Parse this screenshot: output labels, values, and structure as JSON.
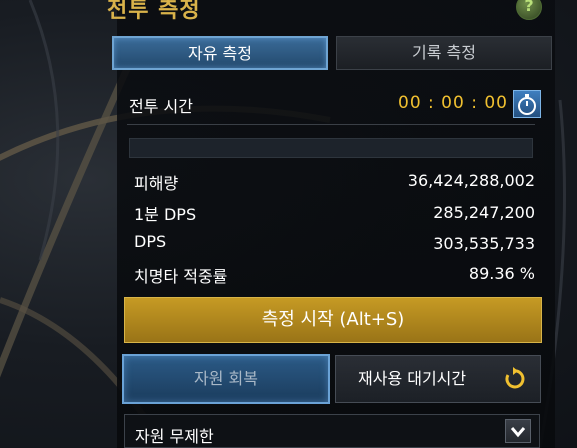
{
  "window": {
    "title": "전투 측정",
    "help_label": "?"
  },
  "tabs": [
    {
      "label": "자유 측정",
      "active": true
    },
    {
      "label": "기록 측정",
      "active": false
    }
  ],
  "combat_time": {
    "label": "전투 시간",
    "value": "00 : 00 : 00",
    "icon": "stopwatch-icon"
  },
  "stats": [
    {
      "label": "피해량",
      "value": "36,424,288,002"
    },
    {
      "label": "1분 DPS",
      "value": "285,247,200"
    },
    {
      "label": "DPS",
      "value": "303,535,733"
    },
    {
      "label": "치명타 적중률",
      "value": "89.36 %"
    }
  ],
  "buttons": {
    "start": "측정 시작 (Alt+S)",
    "resource_recovery": "자원 회복",
    "cooldown": "재사용 대기시간"
  },
  "dropdown": {
    "selected": "자원 무제한"
  },
  "colors": {
    "accent_gold": "#c69a24",
    "timer": "#f0c030",
    "active_blue": "#3a6b98"
  }
}
